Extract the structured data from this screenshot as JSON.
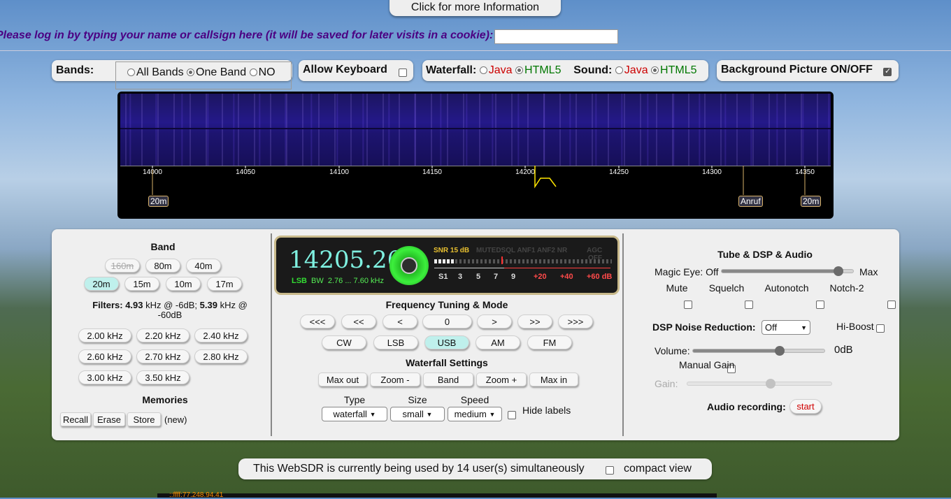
{
  "top": {
    "info_button": "Click for more Information",
    "login_prompt": "Please log in by typing your name or callsign here (it will be saved for later visits in a cookie):"
  },
  "options": {
    "bands_label": "Bands:",
    "bands_options": [
      "All Bands",
      "One Band",
      "NO"
    ],
    "bands_selected": "One Band",
    "allow_keyboard": "Allow Keyboard",
    "waterfall_label": "Waterfall:",
    "sound_label": "Sound:",
    "java": "Java",
    "html5": "HTML5",
    "bg_picture": "Background Picture ON/OFF"
  },
  "waterfall": {
    "ticks": [
      "14000",
      "14050",
      "14100",
      "14150",
      "14200",
      "14250",
      "14300",
      "14350"
    ],
    "markers": [
      "20m",
      "Anruf",
      "20m"
    ]
  },
  "left": {
    "band_title": "Band",
    "bands": [
      "160m",
      "80m",
      "40m",
      "20m",
      "15m",
      "10m",
      "17m"
    ],
    "selected_band": "20m",
    "filters_label": "Filters:",
    "filter_6db": "4.93",
    "filter_6db_text": "kHz @ -6dB;",
    "filter_60db": "5.39",
    "filter_60db_text": "kHz @ -60dB",
    "filter_buttons": [
      "2.00 kHz",
      "2.20 kHz",
      "2.40 kHz",
      "2.60 kHz",
      "2.70 kHz",
      "2.80 kHz",
      "3.00 kHz",
      "3.50 kHz"
    ],
    "memories_title": "Memories",
    "recall": "Recall",
    "erase": "Erase",
    "store": "Store",
    "new": "(new)"
  },
  "display": {
    "frequency": "14205.26",
    "mode": "LSB",
    "bw_label": "BW",
    "bw_value": "2.76 ... 7.60 kHz",
    "snr": "SNR 15 dB",
    "status_flags": "MUTEDSQL ANF1 ANF2 NR",
    "agc": "AGC",
    "agc_state": "OFF",
    "s_scale": [
      "S1",
      "3",
      "5",
      "7",
      "9",
      "+20",
      "+40",
      "+60 dB"
    ]
  },
  "center": {
    "tuning_title": "Frequency Tuning & Mode",
    "step_buttons": [
      "<<<",
      "<<",
      "<",
      "0",
      ">",
      ">>",
      ">>>"
    ],
    "modes": [
      "CW",
      "LSB",
      "USB",
      "AM",
      "FM"
    ],
    "selected_mode": "USB",
    "wf_title": "Waterfall Settings",
    "wf_buttons": [
      "Max out",
      "Zoom -",
      "Band",
      "Zoom +",
      "Max in"
    ],
    "type_label": "Type",
    "size_label": "Size",
    "speed_label": "Speed",
    "type_value": "waterfall",
    "size_value": "small",
    "speed_value": "medium",
    "hide_labels": "Hide labels"
  },
  "right": {
    "title": "Tube & DSP & Audio",
    "magic_eye": "Magic Eye: Off",
    "max": "Max",
    "magic_eye_level": 0.88,
    "mute": "Mute",
    "squelch": "Squelch",
    "autonotch": "Autonotch",
    "notch2": "Notch-2",
    "dsp_label": "DSP Noise Reduction:",
    "dsp_value": "Off",
    "hiboost": "Hi-Boost",
    "volume_label": "Volume:",
    "volume_value": "0dB",
    "volume_level": 0.65,
    "manual_gain": "Manual Gain",
    "gain_label": "Gain:",
    "gain_level": 0.57,
    "audio_rec_label": "Audio recording:",
    "audio_rec_button": "start"
  },
  "bottom": {
    "users_text": "This WebSDR is currently being used by 14 user(s) simultaneously",
    "compact": "compact view",
    "ip_fragment": "::ffff:77.248.94.41"
  },
  "colors": {
    "accent_selected": "#bff0ec",
    "java": "#cc0000",
    "html5": "#007700",
    "login_text": "#4b0082",
    "freq_display": "#7ff0e0"
  }
}
